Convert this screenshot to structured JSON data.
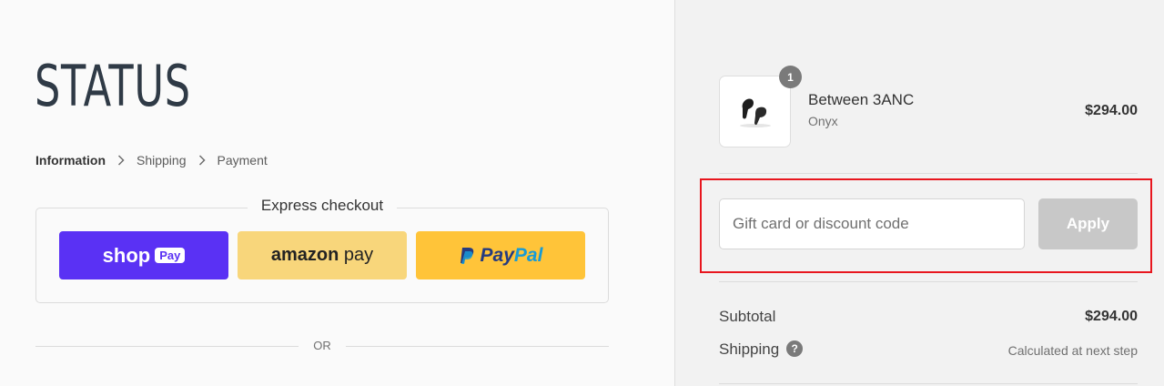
{
  "brand": {
    "logo_text": "STATUS"
  },
  "breadcrumb": {
    "items": [
      {
        "label": "Information",
        "active": true
      },
      {
        "label": "Shipping",
        "active": false
      },
      {
        "label": "Payment",
        "active": false
      }
    ]
  },
  "express_checkout": {
    "title": "Express checkout",
    "shop_pay": {
      "word": "shop",
      "pill": "Pay"
    },
    "amazon_pay": {
      "word1": "amazon",
      "word2": "pay"
    },
    "paypal": {
      "word1": "Pay",
      "word2": "Pal"
    },
    "or_text": "OR"
  },
  "cart": {
    "item": {
      "quantity": "1",
      "name": "Between 3ANC",
      "variant": "Onyx",
      "price": "$294.00"
    }
  },
  "discount": {
    "placeholder": "Gift card or discount code",
    "apply_label": "Apply"
  },
  "summary": {
    "subtotal_label": "Subtotal",
    "subtotal_value": "$294.00",
    "shipping_label": "Shipping",
    "shipping_value": "Calculated at next step",
    "help_icon_glyph": "?"
  },
  "colors": {
    "shop_pay": "#5a31f4",
    "amazon_pay": "#f8d67b",
    "paypal": "#ffc439",
    "highlight": "#e8161e",
    "apply_disabled": "#c8c8c8"
  }
}
